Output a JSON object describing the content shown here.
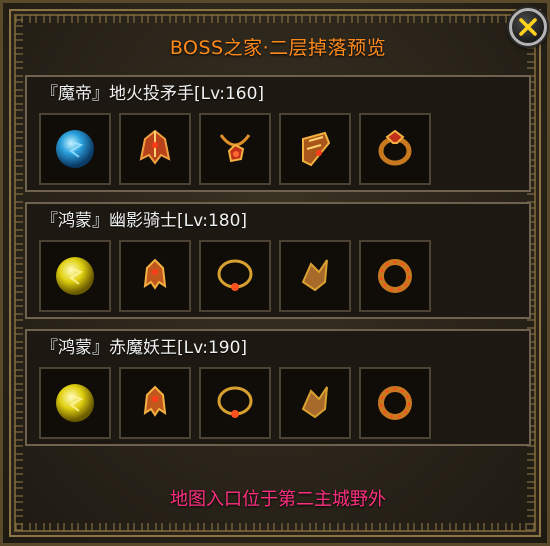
{
  "title": "BOSS之家·二层掉落预览",
  "close_icon": "close-x-icon",
  "colors": {
    "title": "#ff8a1c",
    "footer": "#ff2f80",
    "close_badge": "#ffd21c"
  },
  "sections": [
    {
      "header": "『魔帝』地火投矛手[Lv:160]",
      "items": [
        {
          "icon": "blue-orb-icon"
        },
        {
          "icon": "helmet-icon"
        },
        {
          "icon": "necklace-icon"
        },
        {
          "icon": "bracer-icon"
        },
        {
          "icon": "ring-icon"
        }
      ]
    },
    {
      "header": "『鸿蒙』幽影骑士[Lv:180]",
      "items": [
        {
          "icon": "yellow-orb-icon"
        },
        {
          "icon": "helmet-icon"
        },
        {
          "icon": "necklace-icon"
        },
        {
          "icon": "bracer-icon"
        },
        {
          "icon": "ring-icon"
        }
      ]
    },
    {
      "header": "『鸿蒙』赤魔妖王[Lv:190]",
      "items": [
        {
          "icon": "yellow-orb-icon"
        },
        {
          "icon": "helmet-icon"
        },
        {
          "icon": "necklace-icon"
        },
        {
          "icon": "bracer-icon"
        },
        {
          "icon": "ring-icon"
        }
      ]
    }
  ],
  "footer": "地图入口位于第二主城野外"
}
